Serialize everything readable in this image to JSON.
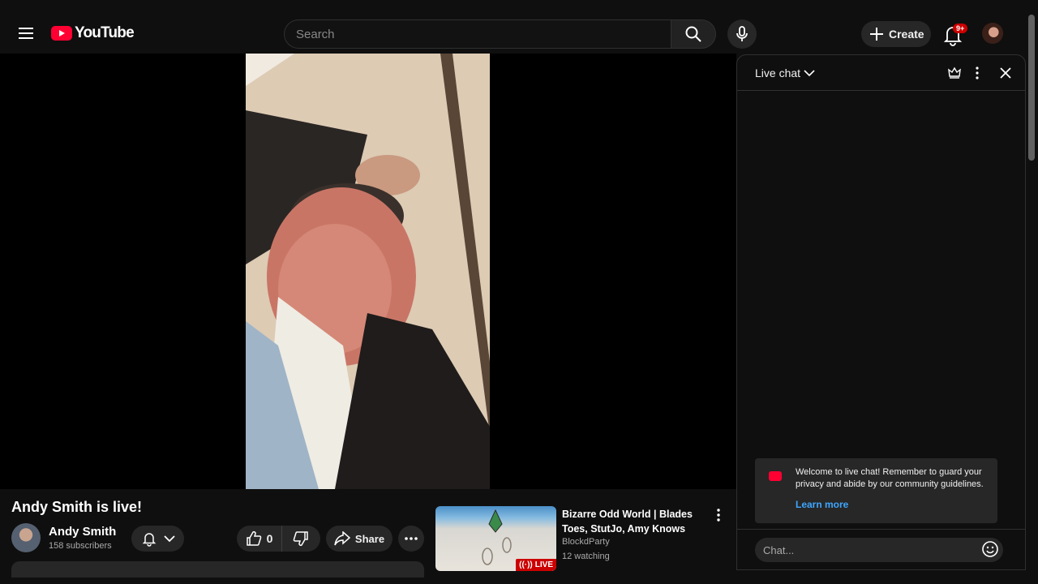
{
  "header": {
    "logo_text": "YouTube",
    "search_placeholder": "Search",
    "create_label": "Create",
    "notification_count": "9+"
  },
  "video": {
    "title": "Andy Smith is live!",
    "channel_name": "Andy Smith",
    "subscribers": "158 subscribers",
    "like_count": "0",
    "share_label": "Share"
  },
  "related": {
    "title": "Bizarre Odd World | Blades Toes, StutJo, Amy Knows",
    "channel": "BlockdParty",
    "watching": "12 watching",
    "badge": "LIVE"
  },
  "chat": {
    "title": "Live chat",
    "welcome": "Welcome to live chat! Remember to guard your privacy and abide by our community guidelines.",
    "learn_more": "Learn more",
    "input_placeholder": "Chat..."
  },
  "colors": {
    "background": "#0f0f0f",
    "surface": "#272727",
    "brand_red": "#ff0033",
    "link_blue": "#3ea6ff"
  }
}
